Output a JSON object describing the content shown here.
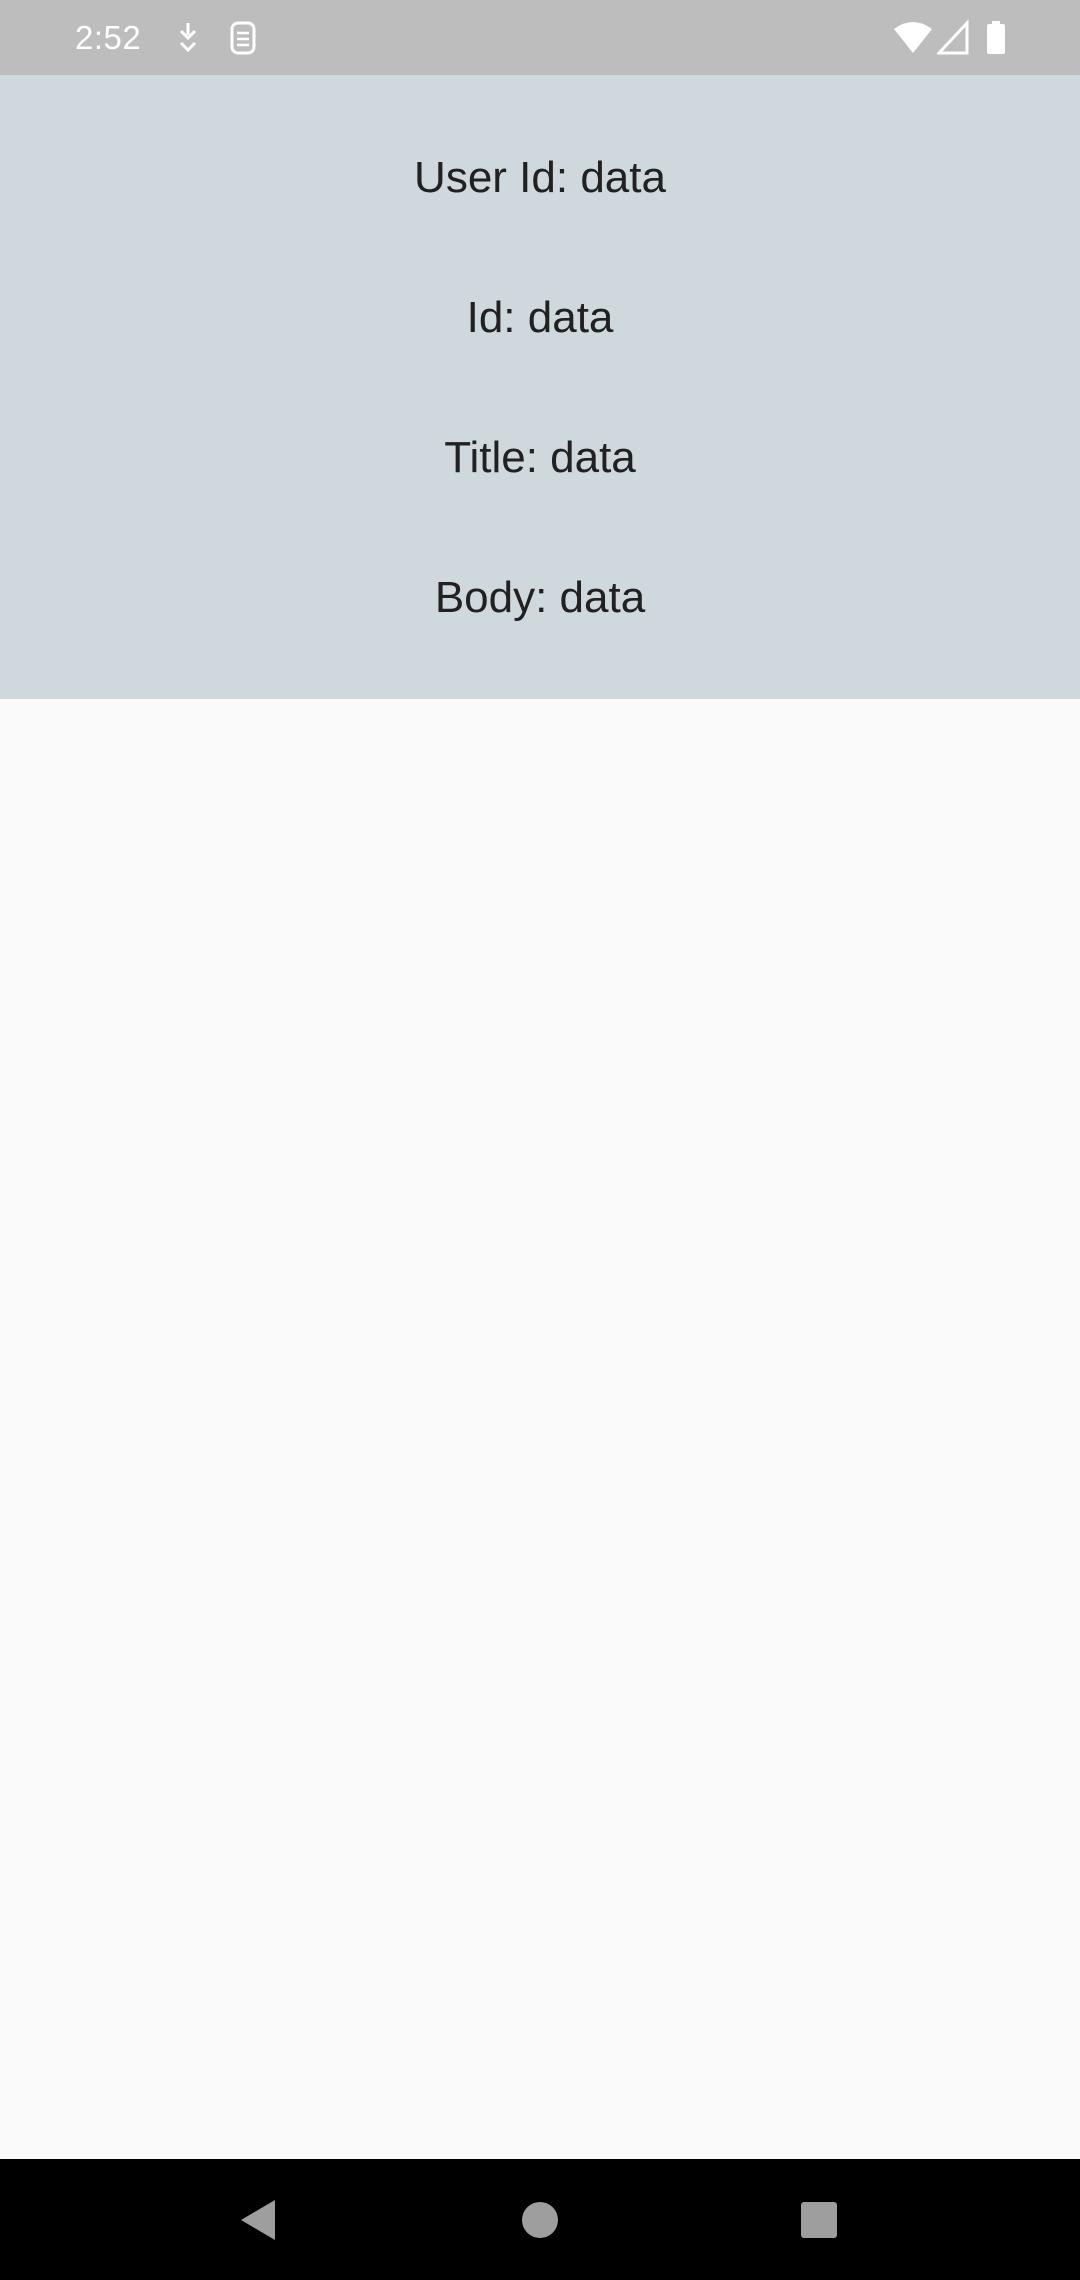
{
  "status_bar": {
    "time": "2:52",
    "icons_left": [
      "download-icon",
      "sim-icon"
    ],
    "icons_right": [
      "wifi-icon",
      "cell-signal-icon",
      "battery-icon"
    ]
  },
  "post": {
    "user_id_text": "User Id: data",
    "id_text": "Id: data",
    "title_text": "Title: data",
    "body_text": "Body: data"
  },
  "nav_bar": {
    "buttons": [
      "back-icon",
      "home-icon",
      "recents-icon"
    ]
  },
  "colors": {
    "status_bar": "#bdbdbd",
    "panel": "#cfd8dc",
    "background": "#fafafa",
    "nav_bar": "#000000"
  }
}
